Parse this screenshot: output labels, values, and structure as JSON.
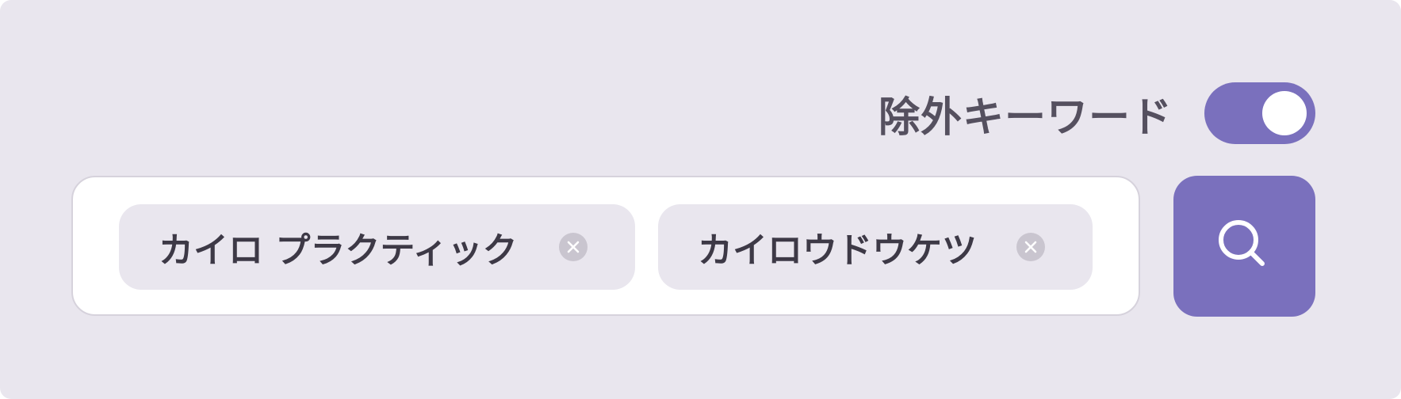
{
  "exclude_keyword": {
    "label": "除外キーワード",
    "toggle_on": true
  },
  "search": {
    "chips": [
      {
        "label": "カイロ プラクティック",
        "remove_icon": "close-circle-icon"
      },
      {
        "label": "カイロウドウケツ",
        "remove_icon": "close-circle-icon"
      }
    ],
    "button_icon": "search-icon"
  },
  "colors": {
    "panel_bg": "#e9e6ee",
    "accent": "#7a70bd",
    "chip_bg": "#e9e6ee",
    "text": "#3d3946",
    "label_text": "#55505f"
  }
}
